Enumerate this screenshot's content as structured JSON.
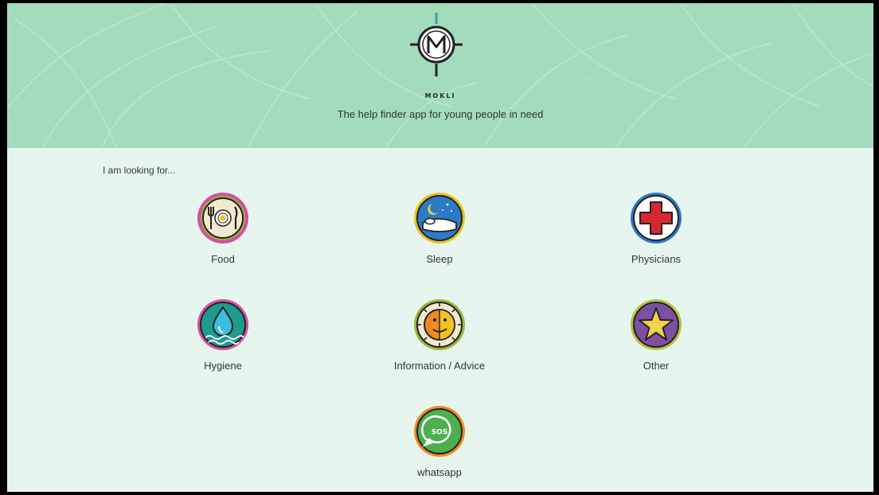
{
  "header": {
    "brand": "MOKLI",
    "tagline": "The help finder app for young people in need"
  },
  "main": {
    "prompt": "I am looking for...",
    "categories": [
      {
        "label": "Food",
        "icon": "plate-cutlery-icon",
        "ring": "#d44fa0"
      },
      {
        "label": "Sleep",
        "icon": "bed-moon-icon",
        "ring": "#e9c21e"
      },
      {
        "label": "Physicians",
        "icon": "red-cross-icon",
        "ring": "#2b7ac5"
      },
      {
        "label": "Hygiene",
        "icon": "water-drop-icon",
        "ring": "#d44fa0"
      },
      {
        "label": "Information / Advice",
        "icon": "face-clock-icon",
        "ring": "#9ab73a"
      },
      {
        "label": "Other",
        "icon": "star-icon",
        "ring": "#b5c23a"
      },
      {
        "label": "whatsapp",
        "icon": "whatsapp-sos-icon",
        "ring": "#ef8a22"
      }
    ]
  },
  "colors": {
    "header_bg": "#a3dcbd",
    "body_bg": "#e6f6ee"
  }
}
